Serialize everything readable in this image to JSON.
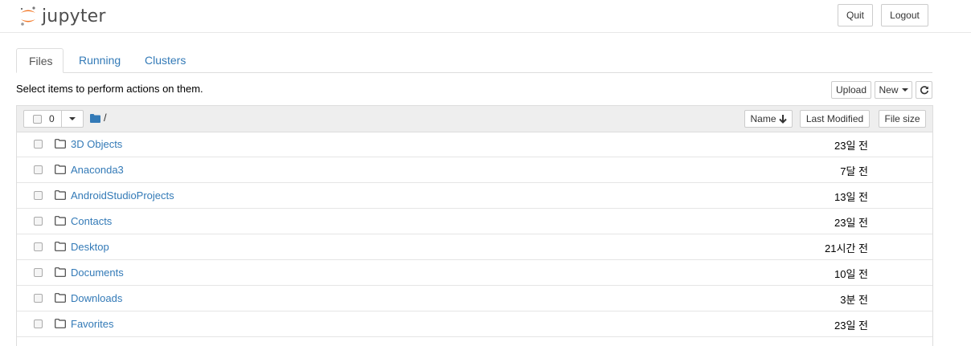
{
  "header": {
    "logo_text": "jupyter",
    "quit_label": "Quit",
    "logout_label": "Logout"
  },
  "tabs": [
    {
      "label": "Files",
      "active": true
    },
    {
      "label": "Running",
      "active": false
    },
    {
      "label": "Clusters",
      "active": false
    }
  ],
  "instructions": "Select items to perform actions on them.",
  "toolbar": {
    "upload_label": "Upload",
    "new_label": "New",
    "refresh_icon": "refresh-icon"
  },
  "list_header": {
    "selected_count": "0",
    "path": "/",
    "sort_name_label": "Name",
    "last_modified_label": "Last Modified",
    "file_size_label": "File size"
  },
  "files": [
    {
      "name": "3D Objects",
      "modified": "23일 전",
      "type": "folder"
    },
    {
      "name": "Anaconda3",
      "modified": "7달 전",
      "type": "folder"
    },
    {
      "name": "AndroidStudioProjects",
      "modified": "13일 전",
      "type": "folder"
    },
    {
      "name": "Contacts",
      "modified": "23일 전",
      "type": "folder"
    },
    {
      "name": "Desktop",
      "modified": "21시간 전",
      "type": "folder"
    },
    {
      "name": "Documents",
      "modified": "10일 전",
      "type": "folder"
    },
    {
      "name": "Downloads",
      "modified": "3분 전",
      "type": "folder"
    },
    {
      "name": "Favorites",
      "modified": "23일 전",
      "type": "folder"
    }
  ],
  "colors": {
    "link": "#337ab7",
    "logo_orange": "#f37726",
    "header_bg": "#eeeeee"
  }
}
